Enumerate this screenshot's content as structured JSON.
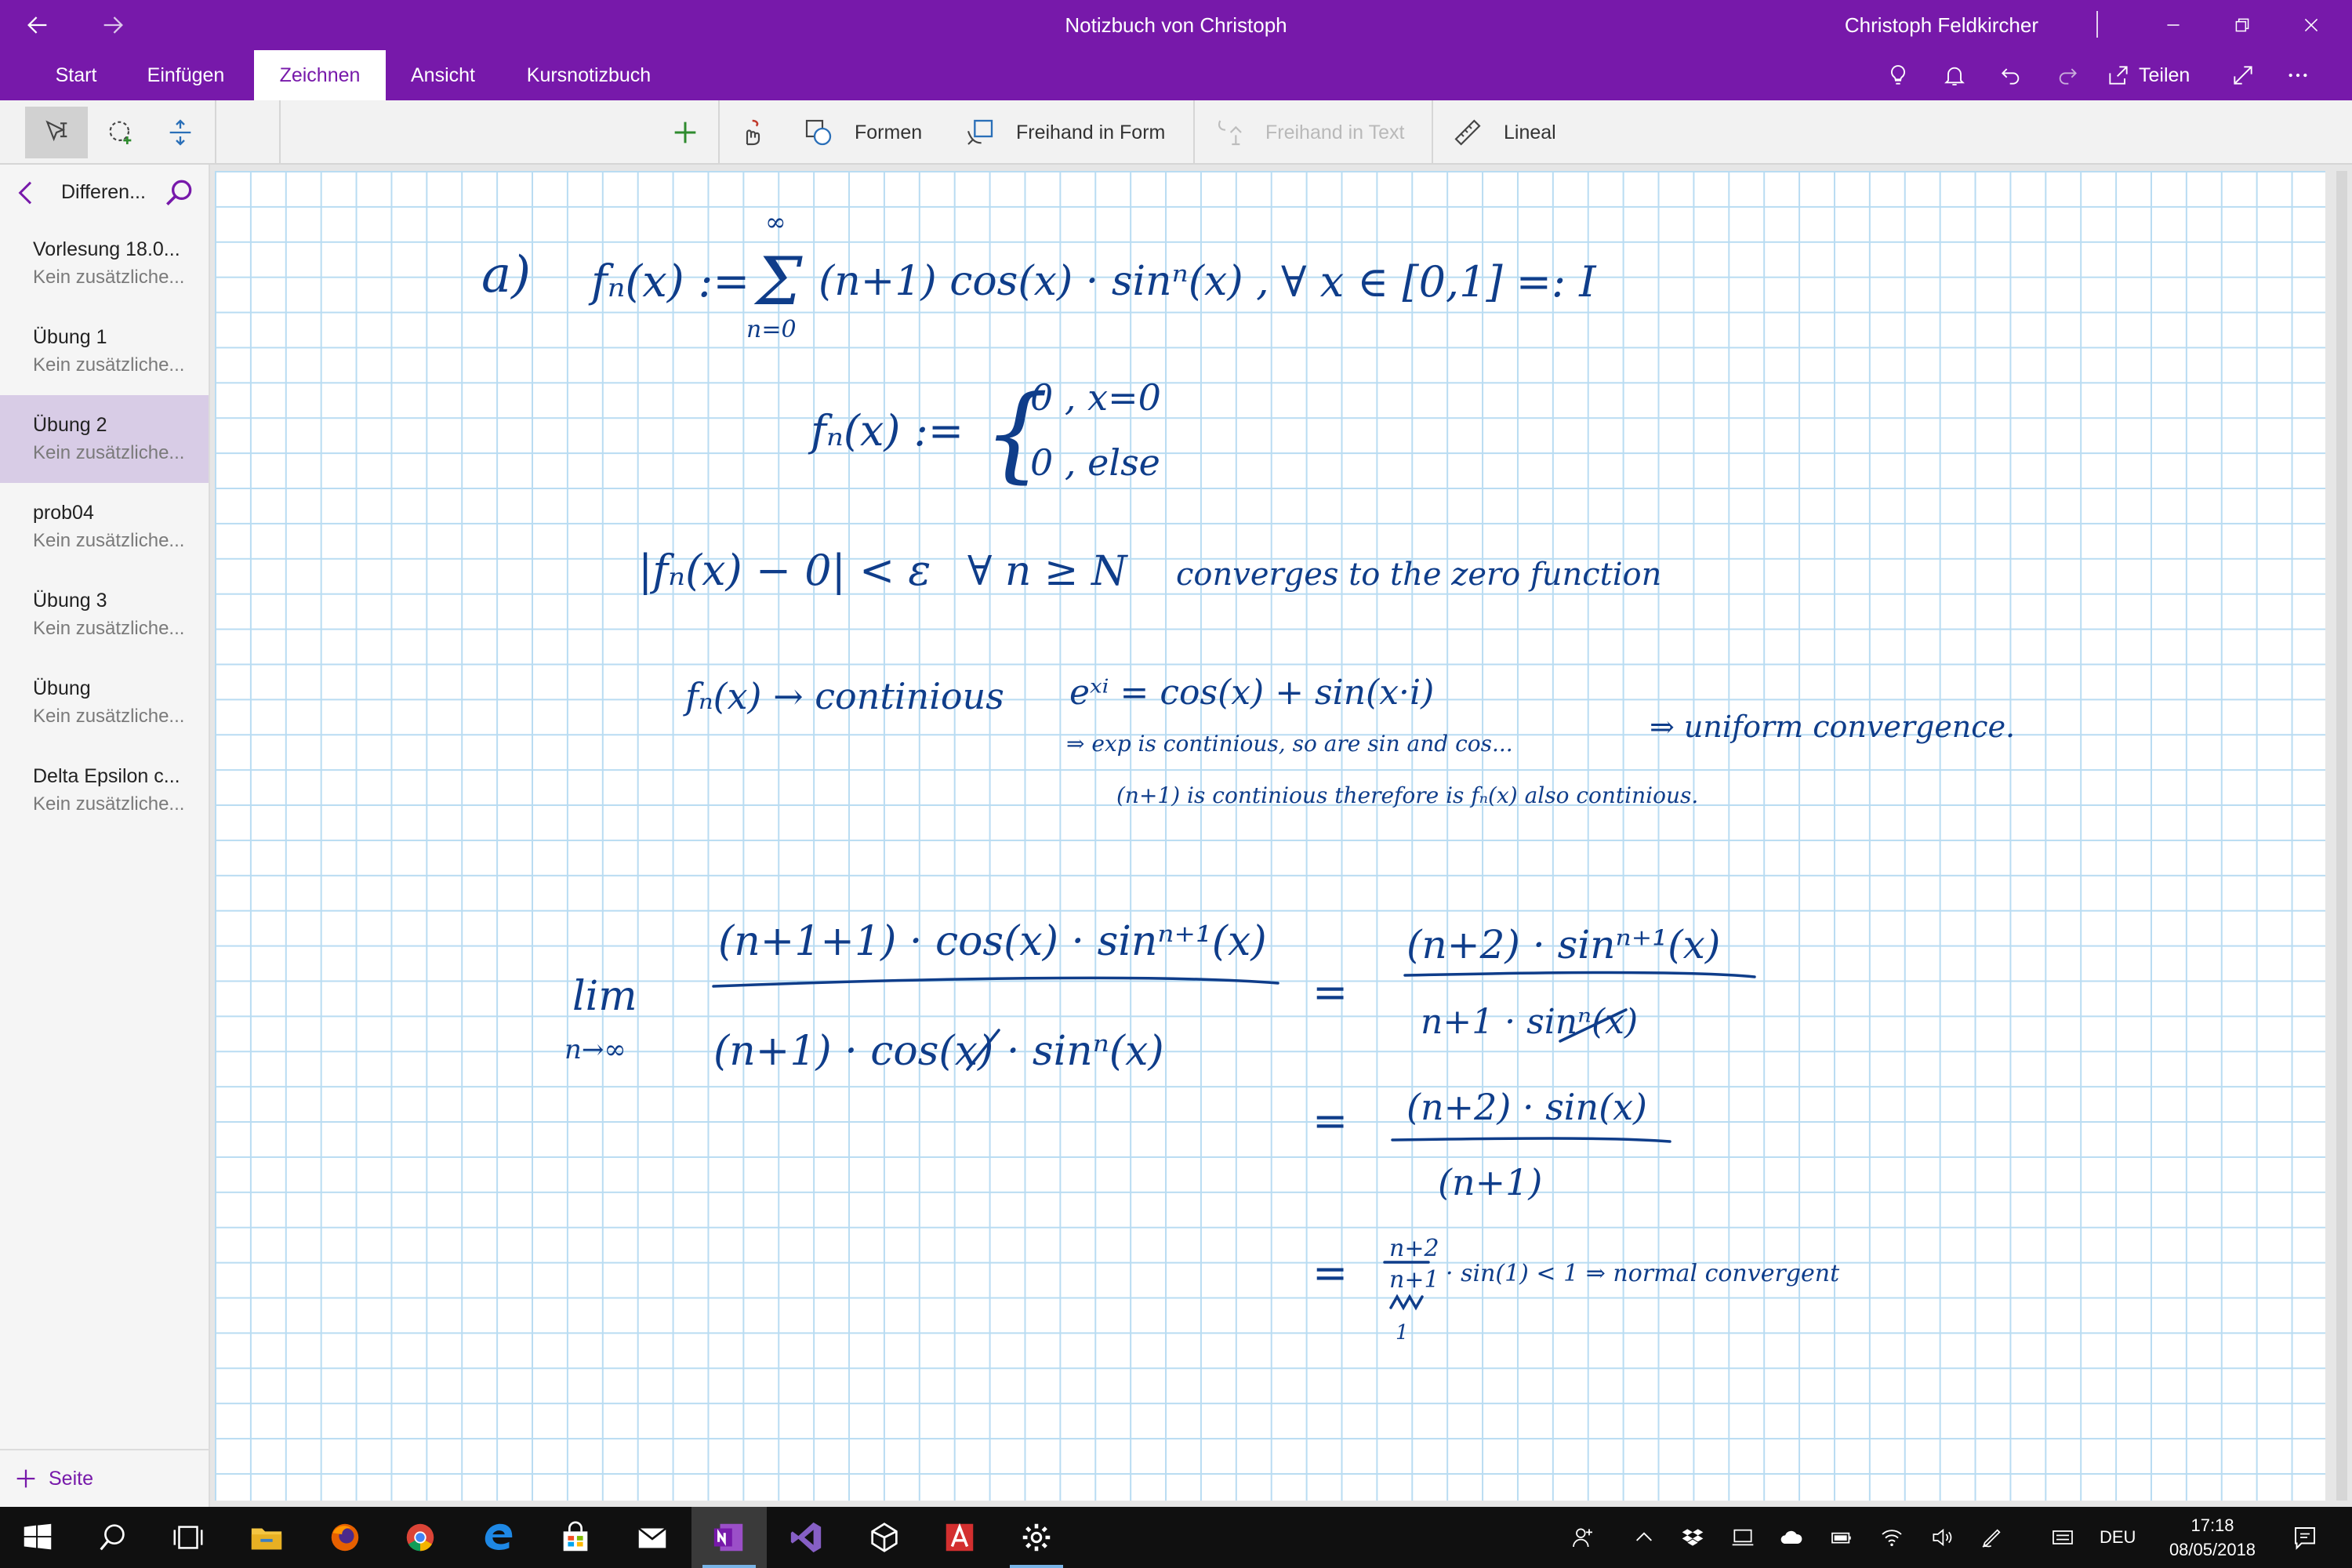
{
  "window": {
    "title": "Notizbuch von Christoph",
    "user": "Christoph Feldkircher"
  },
  "ribbon": {
    "tabs": [
      {
        "label": "Start"
      },
      {
        "label": "Einfügen"
      },
      {
        "label": "Zeichnen",
        "active": true
      },
      {
        "label": "Ansicht"
      },
      {
        "label": "Kursnotizbuch"
      }
    ],
    "share_label": "Teilen"
  },
  "toolbar": {
    "shapes_label": "Formen",
    "ink_to_shape_label": "Freihand in Form",
    "ink_to_text_label": "Freihand in Text",
    "ruler_label": "Lineal"
  },
  "sidebar": {
    "section_title": "Differen...",
    "pages": [
      {
        "title": "Vorlesung 18.0...",
        "subtitle": "Kein zusätzliche..."
      },
      {
        "title": "Übung 1",
        "subtitle": "Kein zusätzliche..."
      },
      {
        "title": "Übung 2",
        "subtitle": "Kein zusätzliche...",
        "active": true
      },
      {
        "title": "prob04",
        "subtitle": "Kein zusätzliche..."
      },
      {
        "title": "Übung 3",
        "subtitle": "Kein zusätzliche..."
      },
      {
        "title": "Übung",
        "subtitle": "Kein zusätzliche..."
      },
      {
        "title": "Delta Epsilon c...",
        "subtitle": "Kein zusätzliche..."
      }
    ],
    "add_page_label": "Seite"
  },
  "note": {
    "ink_color": "#0f3d8a",
    "line1": {
      "label": "a)",
      "lhs": "fₙ(x) :=",
      "sum_top": "∞",
      "sum_sign": "Σ",
      "sum_bottom": "n=0",
      "term": "(n+1) cos(x) · sinⁿ(x) ,",
      "domain": "∀ x ∈ [0,1] =: I"
    },
    "line2": {
      "lhs": "fₙ(x) :=",
      "case1": "0 , x=0",
      "case2": "0 , else"
    },
    "line3": {
      "inequality": "|fₙ(x) − 0| < ε",
      "quantifier": "∀ n ≥ N",
      "text": "converges to the zero function"
    },
    "line4": {
      "lhs": "fₙ(x) → continious",
      "euler": "eˣⁱ = cos(x) + sin(x·i)",
      "note1": "⇒ exp is continious, so are sin and cos...",
      "note2": "(n+1) is continious therefore is fₙ(x) also continious.",
      "conclusion": "⇒ uniform convergence."
    },
    "limit": {
      "lim": "lim",
      "sub": "n→∞",
      "num": "(n+1+1) · cos(x) · sinⁿ⁺¹(x)",
      "den": "(n+1) · cos(x) · sinⁿ(x)",
      "eq1_num": "(n+2) · sinⁿ⁺¹(x)",
      "eq1_den": "n+1 · sinⁿ(x)",
      "eq2_num": "(n+2) · sin(x)",
      "eq2_den": "(n+1)",
      "eq3_num": "n+2",
      "eq3_den": "n+1",
      "eq3_limit": "1",
      "eq3_rest": "· sin(1) < 1 ⇒ normal convergent"
    }
  },
  "taskbar": {
    "language": "DEU",
    "time": "17:18",
    "date": "08/05/2018"
  }
}
